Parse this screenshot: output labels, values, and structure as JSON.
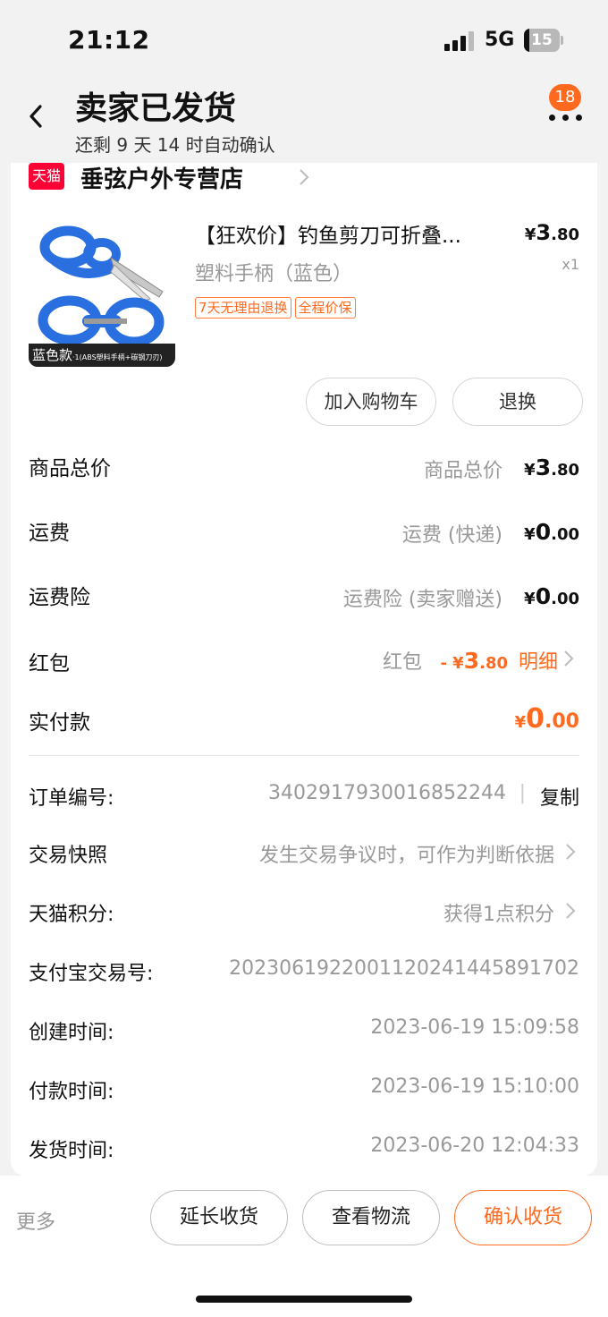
{
  "status_bar": {
    "time": "21:12",
    "network": "5G",
    "battery": "15",
    "battery_level": 0.15
  },
  "header": {
    "title": "卖家已发货",
    "subtitle": "还剩 9 天 14 时自动确认",
    "message_count": "18",
    "icons": {
      "back": "chevron-left-icon",
      "more": "more-dots-icon"
    }
  },
  "shop": {
    "badge": "天猫",
    "name": "垂弦户外专营店"
  },
  "product": {
    "title": "【狂欢价】钓鱼剪刀可折叠...",
    "sku": "塑料手柄（蓝色）",
    "tags": [
      "7天无理由退换",
      "全程价保"
    ],
    "price_symbol": "¥",
    "price_int": "3",
    "price_dec": ".80",
    "quantity": "x1",
    "image_caption": "蓝色款",
    "image_caption_small": "·1(ABS塑料手柄+碳钢刀刃)"
  },
  "actions": {
    "add_to_cart": "加入购物车",
    "return": "退换"
  },
  "fees": [
    {
      "label": "商品总价",
      "desc": "商品总价",
      "symbol": "¥",
      "int": "3",
      "dec": ".80"
    },
    {
      "label": "运费",
      "desc": "运费 (快递)",
      "symbol": "¥",
      "int": "0",
      "dec": ".00"
    },
    {
      "label": "运费险",
      "desc": "运费险 (卖家赠送)",
      "symbol": "¥",
      "int": "0",
      "dec": ".00"
    },
    {
      "label": "红包",
      "desc": "红包",
      "symbol": "- ¥",
      "int": "3",
      "dec": ".80",
      "detail": "明细"
    }
  ],
  "paid": {
    "label": "实付款",
    "symbol": "¥",
    "int": "0",
    "dec": ".00"
  },
  "order_info": {
    "order_no_label": "订单编号:",
    "order_no": "3402917930016852244",
    "separator": "|",
    "copy": "复制",
    "snapshot_label": "交易快照",
    "snapshot_value": "发生交易争议时，可作为判断依据",
    "points_label": "天猫积分:",
    "points_value": "获得1点积分",
    "alipay_label": "支付宝交易号:",
    "alipay_value": "2023061922001120241445891702",
    "created_label": "创建时间:",
    "created_value": "2023-06-19 15:09:58",
    "paid_label": "付款时间:",
    "paid_value": "2023-06-19 15:10:00",
    "shipped_label": "发货时间:",
    "shipped_value": "2023-06-20 12:04:33"
  },
  "bottom_bar": {
    "more": "更多",
    "extend": "延长收货",
    "logistics": "查看物流",
    "confirm": "确认收货"
  },
  "colors": {
    "accent": "#ff6a1f",
    "tmall": "#ff0036",
    "muted": "#999999",
    "background": "#f2f2f2"
  }
}
